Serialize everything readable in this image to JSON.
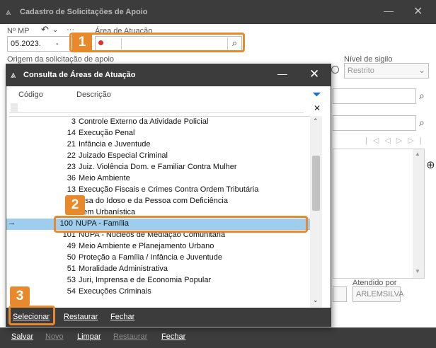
{
  "main": {
    "title": "Cadastro de Solicitações de Apoio",
    "labels": {
      "nmp": "Nº MP",
      "area": "Área de Atuação",
      "origem": "Origem da solicitação de apoio",
      "sigilo": "Nível de sigilo",
      "atendido": "Atendido por"
    },
    "nmp_value": "05.2023.",
    "nmp_sep": "-",
    "sigilo_value": "Restrito",
    "atendido_value": "ARLEMSILVA",
    "toolbar": [
      "Salvar",
      "Novo",
      "Limpar",
      "Restaurar",
      "Fechar"
    ],
    "toolbar_disabled": [
      "Novo",
      "Restaurar"
    ]
  },
  "dialog": {
    "title": "Consulta de Áreas de Atuação",
    "columns": {
      "code": "Código",
      "desc": "Descrição"
    },
    "rows": [
      {
        "code": "3",
        "desc": "Controle Externo da Atividade Policial"
      },
      {
        "code": "14",
        "desc": "Execução Penal"
      },
      {
        "code": "21",
        "desc": "Infância e Juventude"
      },
      {
        "code": "22",
        "desc": "Juizado Especial Criminal"
      },
      {
        "code": "23",
        "desc": "Juiz. Violência Dom. e Familiar Contra Mulher"
      },
      {
        "code": "36",
        "desc": "Meio Ambiente"
      },
      {
        "code": "13",
        "desc": "Execução Fiscais e Crimes Contra Ordem Tributária"
      },
      {
        "code": "",
        "desc": "fesa do Idoso e da Pessoa com Deficiência"
      },
      {
        "code": "",
        "desc": "dem Urbanística"
      },
      {
        "code": "100",
        "desc": "NUPA - Família"
      },
      {
        "code": "101",
        "desc": "NUPA - Núcleos de Mediação Comunitária"
      },
      {
        "code": "49",
        "desc": "Meio Ambiente e Planejamento Urbano"
      },
      {
        "code": "50",
        "desc": "Proteção a Família / Infância e Juventude"
      },
      {
        "code": "51",
        "desc": "Moralidade Administrativa"
      },
      {
        "code": "53",
        "desc": "Juri, Imprensa e de Economia Popular"
      },
      {
        "code": "54",
        "desc": "Execuções Criminais"
      }
    ],
    "selected_index": 9,
    "row_indicator": "→",
    "buttons": [
      "Selecionar",
      "Restaurar",
      "Fechar"
    ]
  },
  "annotations": [
    "1",
    "2",
    "3"
  ],
  "colors": {
    "dark": "#3c3c3c",
    "accent": "#e8892b",
    "selection": "#9fcdee"
  }
}
